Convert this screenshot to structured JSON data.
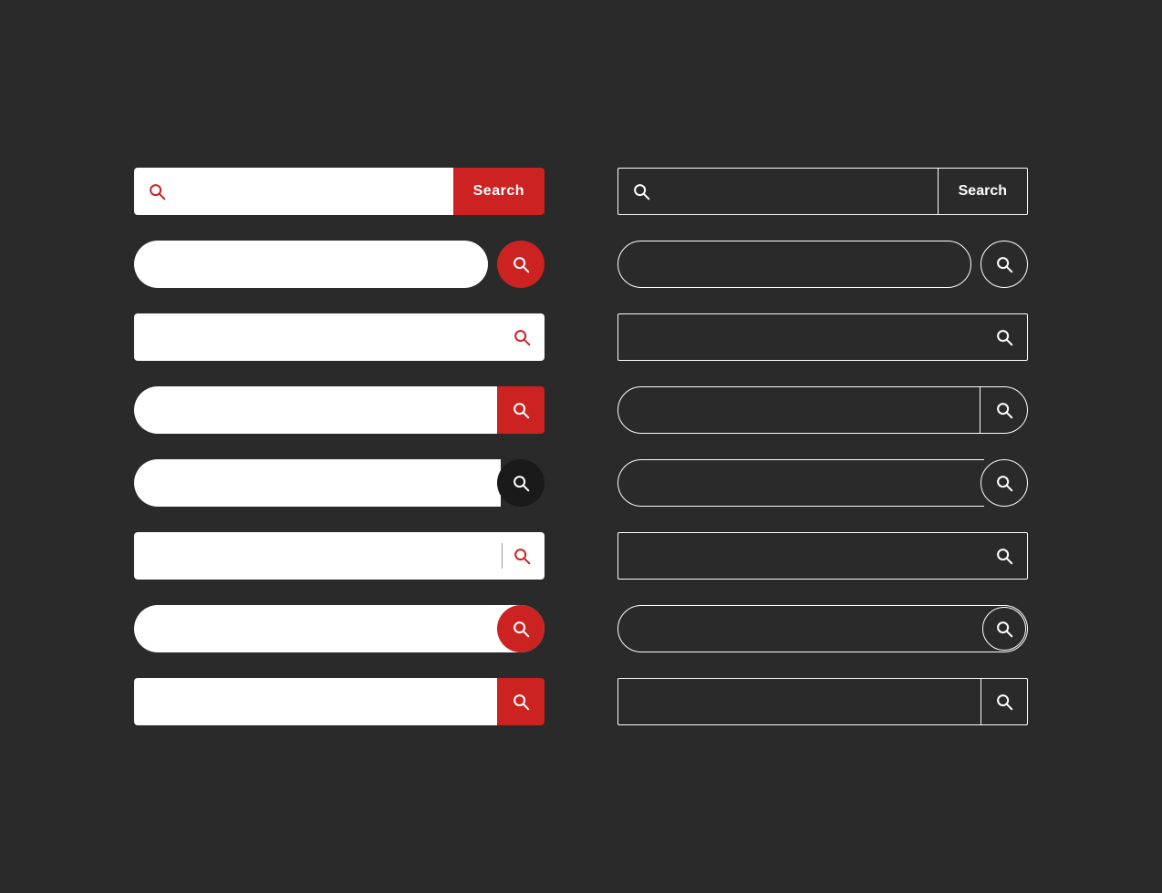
{
  "colors": {
    "bg": "#2a2a2a",
    "red": "#cc2222",
    "white": "#ffffff",
    "dark": "#1a1a1a"
  },
  "left_column": {
    "rows": [
      {
        "id": "bar1",
        "type": "rect-with-text-button",
        "button_label": "Search"
      },
      {
        "id": "bar2",
        "type": "pill-with-red-circle"
      },
      {
        "id": "bar3",
        "type": "flat-rect-icon-right"
      },
      {
        "id": "bar4",
        "type": "pill-left-red-square-right"
      },
      {
        "id": "bar5",
        "type": "pill-left-dark-circle-right"
      },
      {
        "id": "bar6",
        "type": "flat-rect-divider-icon"
      },
      {
        "id": "bar7",
        "type": "pill-red-circle-overlap-right"
      },
      {
        "id": "bar8",
        "type": "flat-rect-small-red-square"
      }
    ]
  },
  "right_column": {
    "rows": [
      {
        "id": "dark-bar1",
        "type": "dark-rect-with-text-button",
        "button_label": "Search"
      },
      {
        "id": "dark-bar2",
        "type": "dark-pill-with-circle"
      },
      {
        "id": "dark-bar3",
        "type": "dark-rect-icon-right"
      },
      {
        "id": "dark-bar4",
        "type": "dark-pill-with-bordered-icon"
      },
      {
        "id": "dark-bar5",
        "type": "dark-pill-circle-right"
      },
      {
        "id": "dark-bar6",
        "type": "dark-rect-icon"
      },
      {
        "id": "dark-bar7",
        "type": "dark-pill-circle-inside"
      },
      {
        "id": "dark-bar8",
        "type": "dark-rect-small-square"
      }
    ]
  }
}
